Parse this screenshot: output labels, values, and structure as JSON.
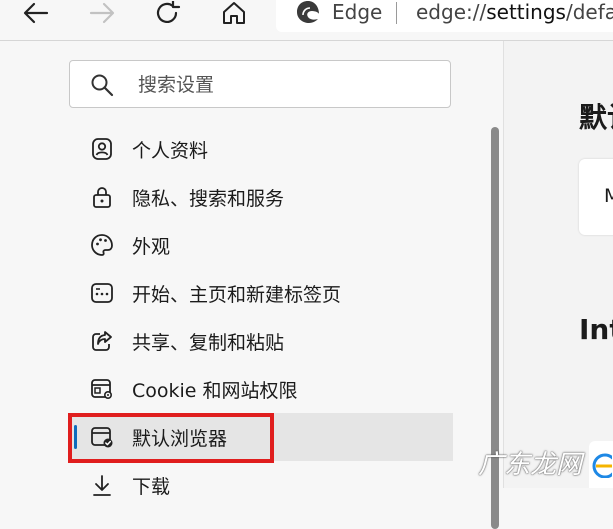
{
  "toolbar": {
    "address_brand": "Edge",
    "address_url_prefix": "edge://",
    "address_url_strong": "settings",
    "address_url_rest": "/defau"
  },
  "sidebar": {
    "search_placeholder": "搜索设置",
    "items": [
      {
        "label": "个人资料",
        "icon": "profile-icon"
      },
      {
        "label": "隐私、搜索和服务",
        "icon": "lock-icon"
      },
      {
        "label": "外观",
        "icon": "palette-icon"
      },
      {
        "label": "开始、主页和新建标签页",
        "icon": "home-grid-icon"
      },
      {
        "label": "共享、复制和粘贴",
        "icon": "share-icon"
      },
      {
        "label": "Cookie 和网站权限",
        "icon": "site-permissions-icon"
      },
      {
        "label": "默认浏览器",
        "icon": "default-browser-icon",
        "active": true
      },
      {
        "label": "下载",
        "icon": "download-icon"
      }
    ]
  },
  "content": {
    "section_title": "默认",
    "card_text": "M",
    "section_title2": "Int"
  },
  "watermark": {
    "text": "广东龙网"
  },
  "colors": {
    "accent": "#0f6cbd",
    "highlight_box": "#e01e1e",
    "background": "#f7f7f7"
  }
}
